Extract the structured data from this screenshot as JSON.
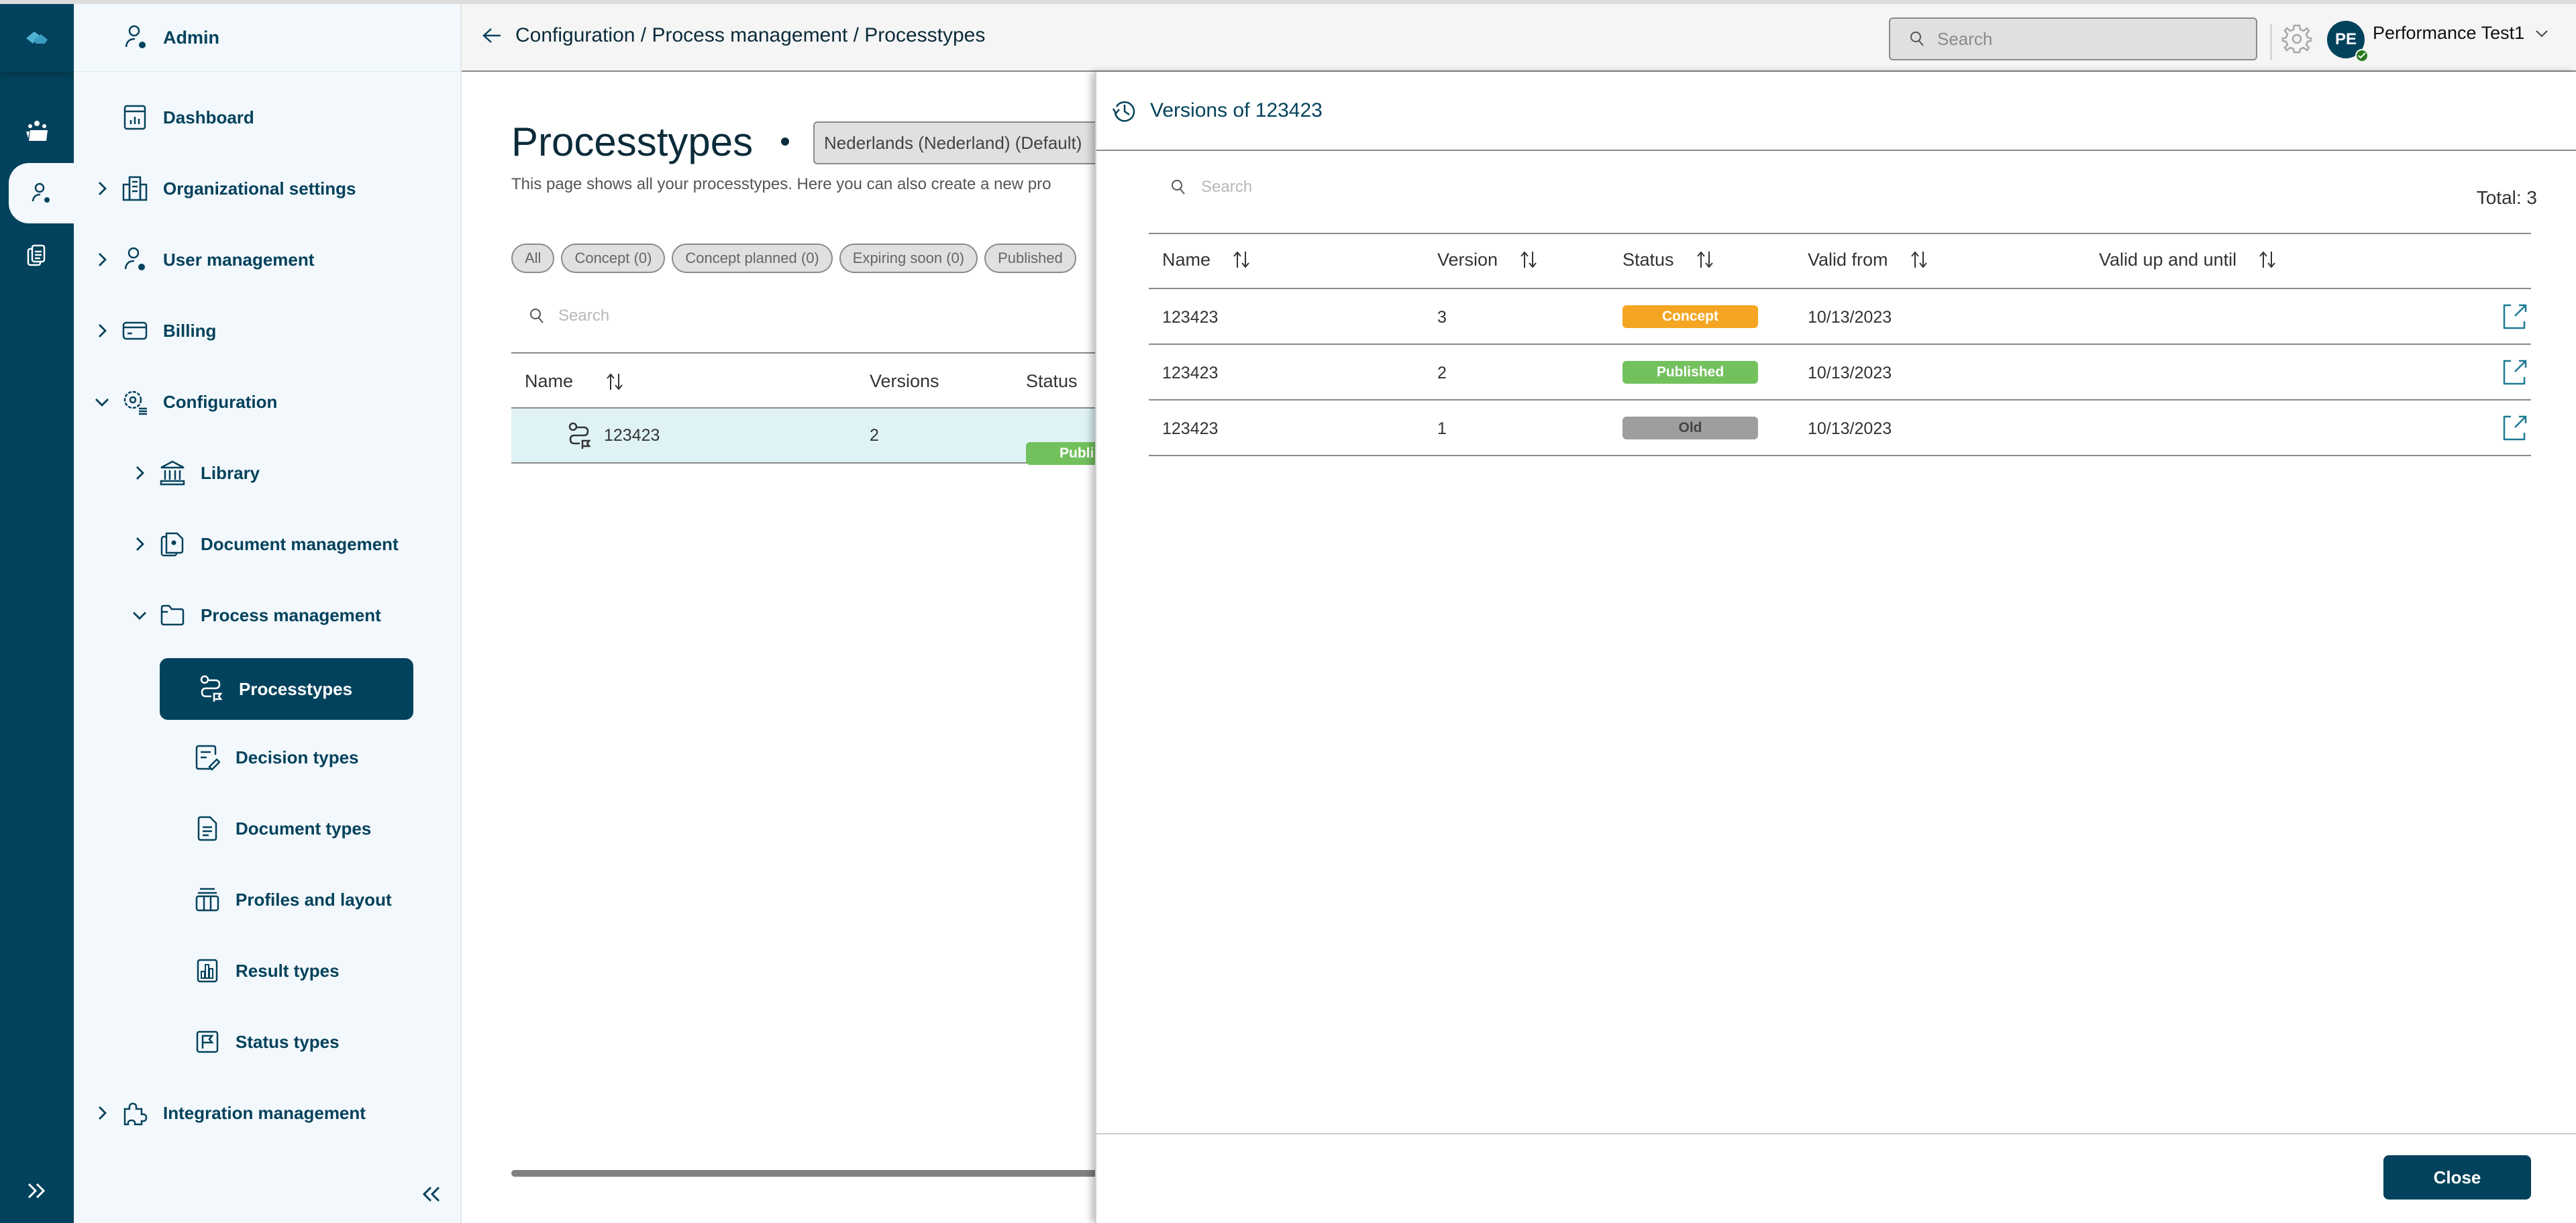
{
  "app": {
    "section": "Admin"
  },
  "rail": {
    "items": [
      {
        "name": "logo",
        "icon": "logo-icon"
      },
      {
        "name": "workspace",
        "icon": "team-icon"
      },
      {
        "name": "admin",
        "icon": "user-gear-icon",
        "active": true
      },
      {
        "name": "documents",
        "icon": "documents-icon"
      }
    ],
    "expand_icon": "double-chevron-right-icon"
  },
  "sidebar": {
    "header": "Admin",
    "items": [
      {
        "label": "Dashboard",
        "icon": "dashboard-icon",
        "level": 0,
        "chevron": "none"
      },
      {
        "label": "Organizational settings",
        "icon": "building-icon",
        "level": 0,
        "chevron": "right"
      },
      {
        "label": "User management",
        "icon": "user-gear-icon",
        "level": 0,
        "chevron": "right"
      },
      {
        "label": "Billing",
        "icon": "credit-card-icon",
        "level": 0,
        "chevron": "right"
      },
      {
        "label": "Configuration",
        "icon": "gear-list-icon",
        "level": 0,
        "chevron": "down"
      },
      {
        "label": "Library",
        "icon": "library-icon",
        "level": 1,
        "chevron": "right"
      },
      {
        "label": "Document management",
        "icon": "document-gear-icon",
        "level": 1,
        "chevron": "right"
      },
      {
        "label": "Process management",
        "icon": "folder-icon",
        "level": 1,
        "chevron": "down"
      },
      {
        "label": "Processtypes",
        "icon": "route-flag-icon",
        "level": 2,
        "active": true
      },
      {
        "label": "Decision types",
        "icon": "decision-icon",
        "level": 2
      },
      {
        "label": "Document types",
        "icon": "document-icon",
        "level": 2
      },
      {
        "label": "Profiles and layout",
        "icon": "layout-icon",
        "level": 2
      },
      {
        "label": "Result types",
        "icon": "bar-chart-icon",
        "level": 2
      },
      {
        "label": "Status types",
        "icon": "flag-icon",
        "level": 2
      },
      {
        "label": "Integration management",
        "icon": "puzzle-icon",
        "level": 0,
        "chevron": "right"
      }
    ],
    "collapse_icon": "double-chevron-left-icon"
  },
  "header": {
    "breadcrumb": "Configuration / Process management / Processtypes",
    "search_placeholder": "Search",
    "user_initials": "PE",
    "user_name": "Performance Test1"
  },
  "main": {
    "title": "Processtypes",
    "language": "Nederlands (Nederland) (Default)",
    "description": "This page shows all your processtypes. Here you can also create a new pro",
    "filters": [
      "All",
      "Concept (0)",
      "Concept planned (0)",
      "Expiring soon (0)",
      "Published"
    ],
    "search_placeholder": "Search",
    "columns": [
      "Name",
      "Versions",
      "Status"
    ],
    "rows": [
      {
        "name": "123423",
        "versions": "2",
        "status": "Publi"
      }
    ]
  },
  "panel": {
    "title": "Versions of 123423",
    "search_placeholder": "Search",
    "total": "Total: 3",
    "columns": [
      "Name",
      "Version",
      "Status",
      "Valid from",
      "Valid up and until"
    ],
    "rows": [
      {
        "name": "123423",
        "version": "3",
        "status": "Concept",
        "status_color": "#f4a623",
        "valid_from": "10/13/2023",
        "valid_until": ""
      },
      {
        "name": "123423",
        "version": "2",
        "status": "Published",
        "status_color": "#72c15d",
        "valid_from": "10/13/2023",
        "valid_until": ""
      },
      {
        "name": "123423",
        "version": "1",
        "status": "Old",
        "status_color": "#9e9e9e",
        "valid_from": "10/13/2023",
        "valid_until": ""
      }
    ],
    "close_label": "Close"
  },
  "colors": {
    "brand": "#03425c",
    "accent_link": "#1b7a93",
    "selected_row": "#dff3f7"
  }
}
